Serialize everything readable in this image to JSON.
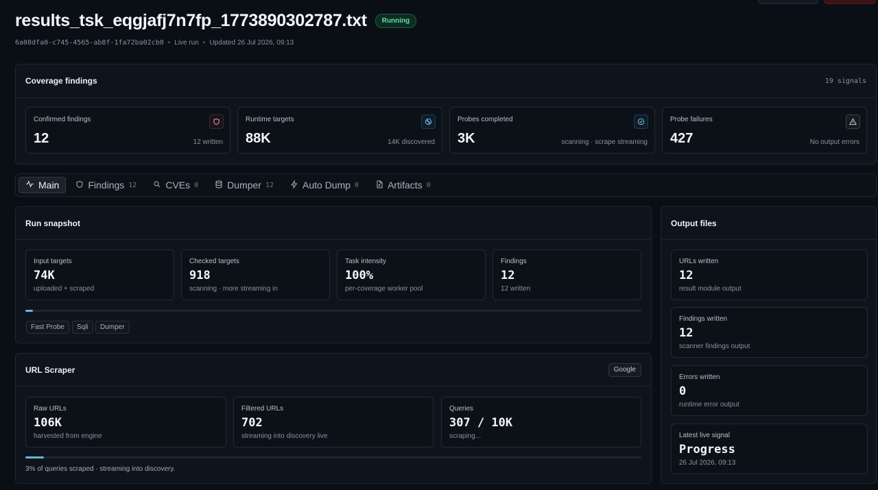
{
  "header": {
    "title": "results_tsk_eqgjafj7n7fp_1773890302787.txt",
    "status": "Running",
    "run_id": "6a08dfa0-c745-4565-ab8f-1fa72ba02cb0",
    "mode": "Live run",
    "updated": "Updated 26 Jul 2026, 09:13"
  },
  "coverage": {
    "title": "Coverage findings",
    "signals": "19 signals",
    "cards": [
      {
        "label": "Confirmed findings",
        "value": "12",
        "sub": "12 written",
        "icon": "shield-icon"
      },
      {
        "label": "Runtime targets",
        "value": "88K",
        "sub": "14K discovered",
        "icon": "globe-icon"
      },
      {
        "label": "Probes completed",
        "value": "3K",
        "sub": "scanning · scrape streaming",
        "icon": "check-circle-icon"
      },
      {
        "label": "Probe failures",
        "value": "427",
        "sub": "No output errors",
        "icon": "warning-icon"
      }
    ]
  },
  "tabs": [
    {
      "label": "Main",
      "count": "",
      "icon": "activity-icon"
    },
    {
      "label": "Findings",
      "count": "12",
      "icon": "shield-icon"
    },
    {
      "label": "CVEs",
      "count": "0",
      "icon": "search-icon"
    },
    {
      "label": "Dumper",
      "count": "12",
      "icon": "database-icon"
    },
    {
      "label": "Auto Dump",
      "count": "0",
      "icon": "bolt-icon"
    },
    {
      "label": "Artifacts",
      "count": "0",
      "icon": "file-icon"
    }
  ],
  "snapshot": {
    "title": "Run snapshot",
    "stats": [
      {
        "label": "Input targets",
        "value": "74K",
        "sub": "uploaded + scraped"
      },
      {
        "label": "Checked targets",
        "value": "918",
        "sub": "scanning · more streaming in"
      },
      {
        "label": "Task intensity",
        "value": "100%",
        "sub": "per-coverage worker pool"
      },
      {
        "label": "Findings",
        "value": "12",
        "sub": "12 written"
      }
    ],
    "progress": 0.012,
    "modules": [
      "Fast Probe",
      "Sqli",
      "Dumper"
    ]
  },
  "scraper": {
    "title": "URL Scraper",
    "engine": "Google",
    "stats": [
      {
        "label": "Raw URLs",
        "value": "106K",
        "sub": "harvested from engine"
      },
      {
        "label": "Filtered URLs",
        "value": "702",
        "sub": "streaming into discovery live"
      },
      {
        "label": "Queries",
        "value": "307 / 10K",
        "sub": "scraping..."
      }
    ],
    "progress": 0.03,
    "note": "3% of queries scraped · streaming into discovery."
  },
  "output": {
    "title": "Output files",
    "cards": [
      {
        "label": "URLs written",
        "value": "12",
        "sub": "result module output"
      },
      {
        "label": "Findings written",
        "value": "12",
        "sub": "scanner findings output"
      },
      {
        "label": "Errors written",
        "value": "0",
        "sub": "runtime error output"
      },
      {
        "label": "Latest live signal",
        "value": "Progress",
        "sub": "26 Jul 2026, 09:13"
      }
    ]
  },
  "colors": {
    "accent": "#6fb3d6",
    "running": "#5fe0a4",
    "background": "#0a0e15"
  }
}
